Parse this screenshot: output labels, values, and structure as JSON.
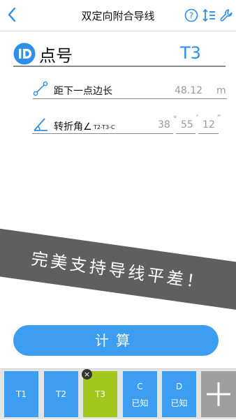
{
  "header": {
    "title": "双定向附合导线",
    "icons": [
      "back-chevron-icon",
      "help-icon",
      "sort-icon",
      "wrench-icon"
    ]
  },
  "point": {
    "icon": "id-icon",
    "label": "点号",
    "value": "T3"
  },
  "distance": {
    "icon": "line-segment-icon",
    "label": "距下一点边长",
    "placeholder": "48.12",
    "unit": "m"
  },
  "angle": {
    "icon": "angle-icon",
    "label": "转折角∠",
    "subscript": "T2-T3-C",
    "degrees": "38",
    "degree_symbol": "°",
    "minutes": "55",
    "minute_symbol": "′",
    "seconds": "12",
    "second_symbol": "″"
  },
  "banner": {
    "text": "完美支持导线平差！"
  },
  "calculate": {
    "label": "计算"
  },
  "tabs": [
    {
      "line1": "T1"
    },
    {
      "line1": "T2"
    },
    {
      "line1": "T3"
    },
    {
      "line1": "C",
      "line2": "已知"
    },
    {
      "line1": "D",
      "line2": "已知"
    }
  ],
  "close_badge": "×",
  "colors": {
    "accent": "#3d9df0",
    "active_tab": "#a2c81d",
    "banner": "#5f5f5f",
    "add_button": "#9e9e9e"
  }
}
